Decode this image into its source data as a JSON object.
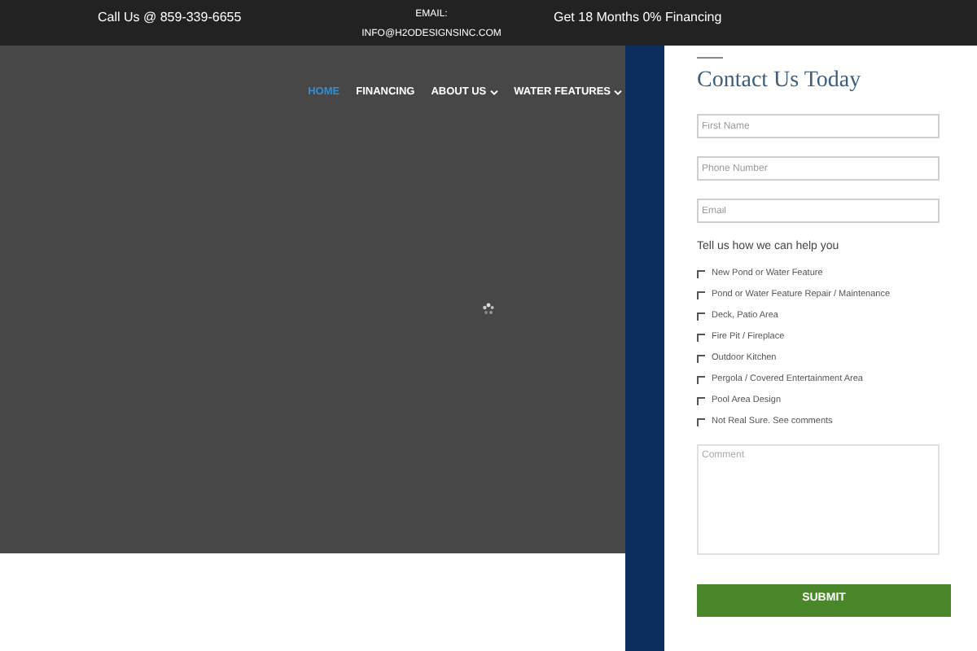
{
  "top_bar": {
    "phone": "Call Us @ 859-339-6655",
    "email_label": "EMAIL:",
    "email": "INFO@H2ODESIGNSINC.COM",
    "promo": "Get 18 Months 0% Financing"
  },
  "nav": [
    {
      "label": "HOME",
      "selected": true,
      "dropdown": false
    },
    {
      "label": "FINANCING",
      "selected": false,
      "dropdown": false
    },
    {
      "label": "ABOUT US",
      "selected": false,
      "dropdown": true
    },
    {
      "label": "WATER FEATURES",
      "selected": false,
      "dropdown": true
    }
  ],
  "form": {
    "title": "Contact Us Today",
    "fields": [
      {
        "placeholder": "First Name"
      },
      {
        "placeholder": "Phone Number"
      },
      {
        "placeholder": "Email"
      }
    ],
    "prompt": "Tell us how we can help you",
    "options": [
      {
        "label": "New Pond or Water Feature",
        "checked": false
      },
      {
        "label": "Pond or Water Feature Repair / Maintenance",
        "checked": false
      },
      {
        "label": "Deck, Patio Area",
        "checked": false
      },
      {
        "label": "Fire Pit / Fireplace",
        "checked": false
      },
      {
        "label": "Outdoor Kitchen",
        "checked": false
      },
      {
        "label": "Pergola / Covered Entertainment Area",
        "checked": false
      },
      {
        "label": "Pool Area Design",
        "checked": false
      },
      {
        "label": "Not Real Sure. See comments",
        "checked": false
      }
    ],
    "comment_placeholder": "Comment",
    "submit": "SUBMIT"
  }
}
